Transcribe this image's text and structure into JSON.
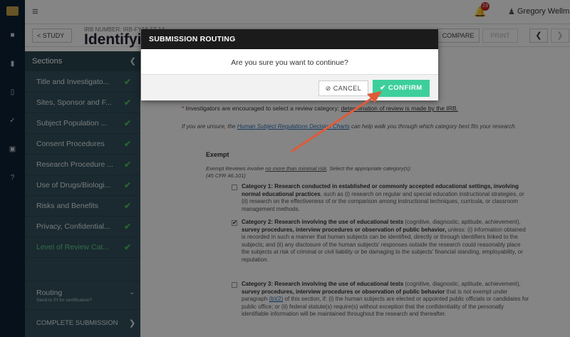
{
  "rail": {
    "icons": [
      "home-icon",
      "folder-icon",
      "document-icon",
      "check-icon",
      "calendar-icon",
      "help-icon"
    ]
  },
  "topbar": {
    "menu_icon": "≡",
    "notification_count": "23",
    "user_name": "Gregory Wellman"
  },
  "header": {
    "back_label": "STUDY",
    "irb_label": "IRB NUMBER: IRB-FY16-17-14",
    "title": "Identifying",
    "compare_label": "COMPARE",
    "faded_label": "PRINT"
  },
  "sidebar": {
    "heading": "Sections",
    "items": [
      {
        "label": "Title and Investigato...",
        "complete": true
      },
      {
        "label": "Sites, Sponsor and F...",
        "complete": true
      },
      {
        "label": "Subject Population ...",
        "complete": true
      },
      {
        "label": "Consent Procedures",
        "complete": true
      },
      {
        "label": "Research Procedure ...",
        "complete": true
      },
      {
        "label": "Use of Drugs/Biologi...",
        "complete": true
      },
      {
        "label": "Risks and Benefits",
        "complete": true
      },
      {
        "label": "Privacy, Confidential...",
        "complete": true
      },
      {
        "label": "Level of Review Cat...",
        "complete": true
      }
    ],
    "routing_title": "Routing",
    "routing_subtitle": "Send to PI for certification?",
    "complete_label": "COMPLETE SUBMISSION"
  },
  "content": {
    "intro": "Investigators are encouraged to select a review category;",
    "intro_underlined": "determination of review is made by the IRB.",
    "unsure_text": "If you are unsure, the",
    "unsure_link": "Human Subject Regulations Decision Charts",
    "unsure_rest": "can help walk you through which category best fits your research.",
    "exempt_title": "Exempt",
    "exempt_desc_a": "Exempt Reviews involve",
    "exempt_desc_u": "no more than minimal risk",
    "exempt_desc_b": ". Select the appropriate category(s):",
    "exempt_cfr": "(45 CFR 46.101)",
    "categories": [
      {
        "checked": false,
        "bold": "Category 1: Research conducted in established or commonly accepted educational settings, involving normal educational practices",
        "rest": ", such as (i) research on regular and special education instructional strategies, or (ii) research on the effectiveness of or the comparison among instructional techniques, curricula, or classroom management methods."
      },
      {
        "checked": true,
        "bold": "Category 2: Research involving the use of educational tests",
        "mid": " (cognitive, diagnostic, aptitude, achievement), ",
        "bold2": "survey procedures, interview procedures or observation of public behavior,",
        "rest": " unless: (i) information obtained is recorded in such a manner that human subjects can be identified, directly or through identifiers linked to the subjects; and (ii) any disclosure of the human subjects' responses outside the research could reasonably place the subjects at risk of criminal or civil liability or be damaging to the subjects' financial standing, employability, or reputation."
      },
      {
        "checked": false,
        "bold": "Category 3: Research involving the use of educational tests",
        "mid": " (cognitive, diagnostic, aptitude, achievement), ",
        "bold2": "survey procedures, interview procedures or observation of public behavior",
        "rest_a": " that is not exempt under paragraph ",
        "link": "(b)(2)",
        "rest_b": " of this section, if: (i) the human subjects are elected or appointed public officials or candidates for public office; or (ii) federal statute(s) require(s) without exception that the confidentiality of the personally identifiable information will be maintained throughout the research and thereafter."
      }
    ]
  },
  "modal": {
    "title": "SUBMISSION ROUTING",
    "message": "Are you sure you want to continue?",
    "cancel_label": "CANCEL",
    "confirm_label": "CONFIRM"
  },
  "colors": {
    "confirm": "#3ccf9c",
    "sidebar": "#33515c",
    "rail": "#0f2234",
    "check": "#4dbf5c",
    "arrow": "#e05a3a"
  }
}
